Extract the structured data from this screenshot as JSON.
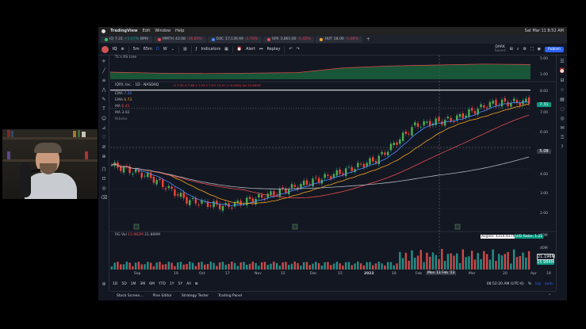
{
  "mac_menu": {
    "app_name": "TradingView",
    "items": [
      "Edit",
      "Window",
      "Help"
    ],
    "clock": "Sat Mar 11 8:52 AM"
  },
  "tabs": [
    {
      "label": "IQ",
      "price": "7.31",
      "change": "+1.07%",
      "suffix": "BMV"
    },
    {
      "label": "MMTH",
      "price": "43.08",
      "change": "-16.85%"
    },
    {
      "label": "DXC",
      "price": "17,136.69",
      "change": "-1.76%"
    },
    {
      "label": "SPX",
      "price": "3,861.60",
      "change": "-1.45%"
    },
    {
      "label": "HUT",
      "price": "18.00",
      "change": "-1.06%"
    }
  ],
  "toolbar": {
    "symbol": "IQ",
    "intervals": [
      "5m",
      "65m",
      "D",
      "W"
    ],
    "indicators": "Indicators",
    "alert": "Alert",
    "replay": "Replay",
    "theme": "DARK",
    "theme_sub": "Saved",
    "publish": "Publish"
  },
  "rs_panel": {
    "label": "TL's RS Line",
    "scale": [
      "5.00",
      "1.00"
    ]
  },
  "main_header": {
    "title": "iQIYI, Inc. · 1D · NASDAQ",
    "ohlc": "O 7.50  H 7.68  L 7.03  C 7.03  +0.07 (+0.94%)  Vol 15.982M"
  },
  "ema_labels": [
    {
      "name": "EMA",
      "value": "7.20"
    },
    {
      "name": "EMA",
      "value": "6.73"
    },
    {
      "name": "MA",
      "value": "6.41"
    },
    {
      "name": "MA",
      "value": "3.92"
    },
    {
      "name": "Nibeko",
      "value": ""
    }
  ],
  "price_scale": [
    "8.00",
    "7.00",
    "6.00",
    "5.08",
    "5.00",
    "4.00",
    "3.00",
    "2.00",
    "1.00"
  ],
  "price_tags": {
    "last": "7.31",
    "crosshair": "5.08"
  },
  "volume": {
    "label": "RG Vol",
    "val1": "15.982M",
    "val2": "21.869M",
    "scale": [
      "60M",
      "40M",
      "20M"
    ],
    "avg_label": "AvgVol: $154.937M",
    "ud_label": "U/D Ratio: 1.21",
    "tag_1": "21.196M",
    "tag_2": "15.984M"
  },
  "time_axis": [
    "Sep",
    "19",
    "Oct",
    "17",
    "Nov",
    "15",
    "Dec",
    "15",
    "2023",
    "18",
    "Feb",
    "Mon 13 Feb '23",
    "Mar",
    "20",
    "Apr",
    "19"
  ],
  "timeframes": [
    "1D",
    "5D",
    "1M",
    "3M",
    "6M",
    "YTD",
    "1Y",
    "5Y",
    "All"
  ],
  "clock_bottom": "08:52:20 AM (UTC-6)",
  "axis_modes": [
    "%",
    "log",
    "auto"
  ],
  "bottom_tabs": [
    "Stock Screen...",
    "Pine Editor",
    "Strategy Tester",
    "Trading Panel"
  ],
  "chart_data": {
    "type": "candlestick",
    "title": "iQIYI, Inc. · 1D · NASDAQ",
    "x_range": [
      "Sep 2022",
      "Apr 2023"
    ],
    "y_range": [
      1.0,
      8.0
    ],
    "series": [
      {
        "name": "price",
        "ohlc_points": [
          [
            "Sep",
            4.2,
            4.0
          ],
          [
            "Oct",
            3.6,
            3.4
          ],
          [
            "Oct late",
            2.4,
            2.2
          ],
          [
            "Nov",
            2.1,
            1.9
          ],
          [
            "Nov mid",
            2.6,
            2.4
          ],
          [
            "Dec",
            3.2,
            3.0
          ],
          [
            "Dec mid",
            3.8,
            3.6
          ],
          [
            "Jan",
            4.5,
            4.2
          ],
          [
            "Jan mid",
            6.2,
            5.5
          ],
          [
            "Feb",
            6.5,
            6.0
          ],
          [
            "Feb mid",
            7.3,
            7.0
          ],
          [
            "Mar",
            7.4,
            7.0
          ]
        ]
      },
      {
        "name": "RS Line",
        "values": [
          1.5,
          1.3,
          1.2,
          1.3,
          1.4,
          2.4,
          2.8,
          3.0,
          3.2,
          3.1
        ]
      }
    ]
  }
}
